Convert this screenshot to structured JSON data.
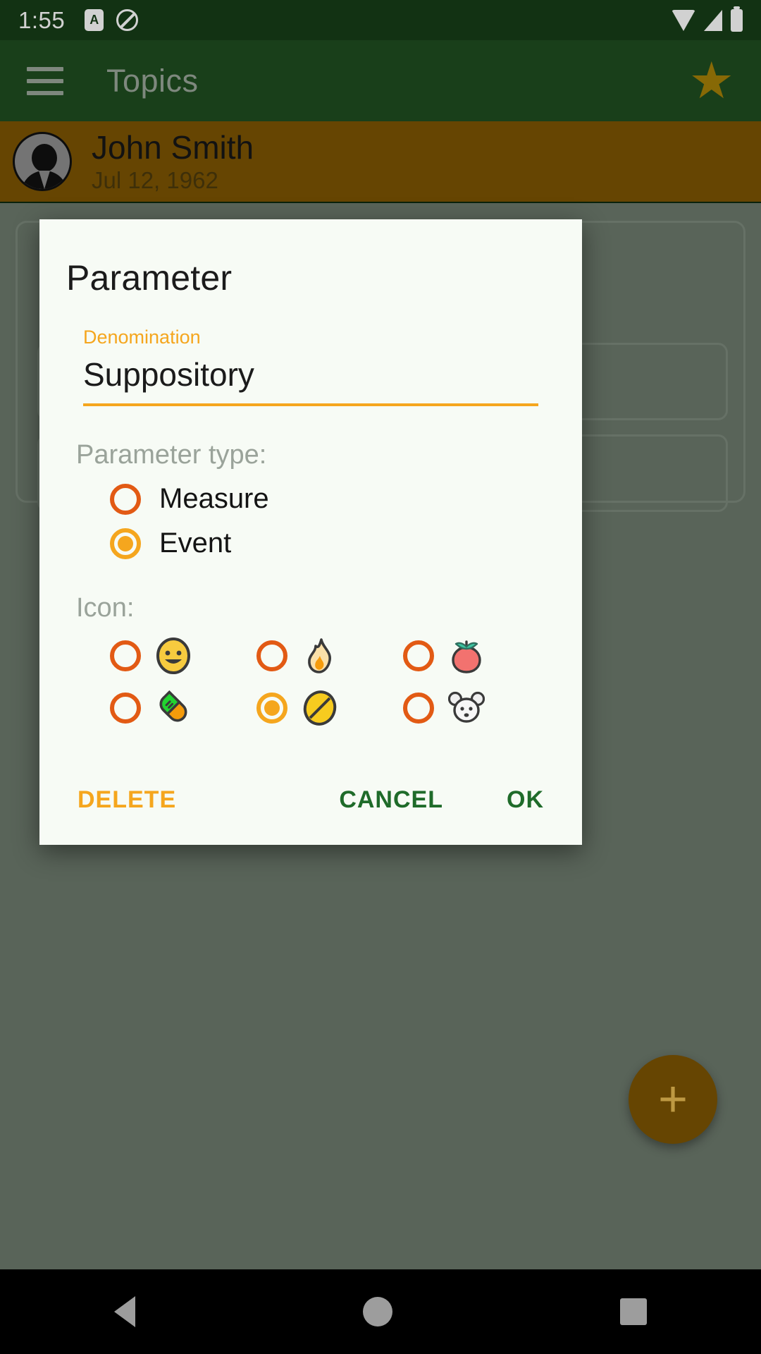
{
  "status_bar": {
    "time": "1:55",
    "icons_left": [
      "app-badge-a-icon",
      "do-not-disturb-icon"
    ],
    "icons_right": [
      "wifi-icon",
      "cell-signal-icon",
      "battery-icon"
    ]
  },
  "app_bar": {
    "menu_icon": "hamburger-menu-icon",
    "title": "Topics",
    "star_icon": "star-icon",
    "star_glyph": "★",
    "background_color": "#1f4d20"
  },
  "patient": {
    "name": "John Smith",
    "dob": "Jul 12, 1962",
    "avatar_icon": "person-avatar-icon",
    "background_color": "#7d5503"
  },
  "fab": {
    "label": "+",
    "icon": "add-plus-icon",
    "color": "#7d5503"
  },
  "dialog": {
    "title": "Parameter",
    "field": {
      "label": "Denomination",
      "value": "Suppository",
      "placeholder": "Denomination",
      "accent_color": "#f5a61e"
    },
    "parameter_type": {
      "label": "Parameter type:",
      "options": [
        {
          "label": "Measure",
          "selected": false
        },
        {
          "label": "Event",
          "selected": true
        }
      ]
    },
    "icon_section": {
      "label": "Icon:",
      "options": [
        {
          "name": "smiley-face-emoji",
          "glyph": "😀",
          "selected": false
        },
        {
          "name": "flame-emoji",
          "glyph": "🔥",
          "selected": false
        },
        {
          "name": "tomato-emoji",
          "glyph": "🍅",
          "selected": false
        },
        {
          "name": "capsule-pill-emoji",
          "glyph": "💊",
          "selected": false
        },
        {
          "name": "tablet-pill-emoji",
          "glyph": "💊",
          "selected": true
        },
        {
          "name": "mouse-face-emoji",
          "glyph": "🐭",
          "selected": false
        }
      ]
    },
    "actions": {
      "delete": "DELETE",
      "cancel": "CANCEL",
      "ok": "OK",
      "delete_color": "#f5a61e",
      "cancel_color": "#1f6b2a",
      "ok_color": "#1f6b2a"
    }
  },
  "nav_bar": {
    "back": "back-triangle-icon",
    "home": "home-circle-icon",
    "recents": "recents-square-icon"
  }
}
